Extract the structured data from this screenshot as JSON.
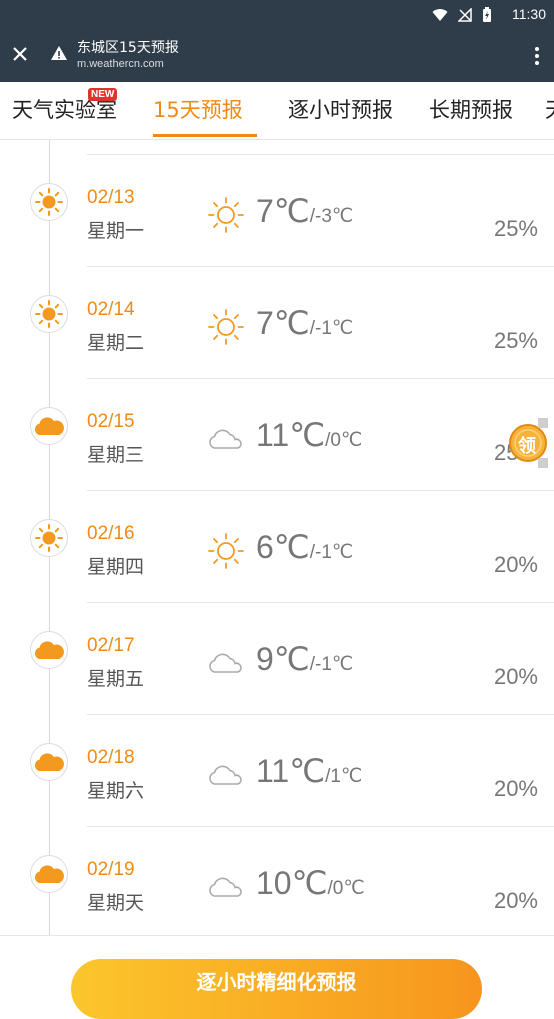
{
  "status_bar": {
    "time": "11:30"
  },
  "toolbar": {
    "title": "东城区15天预报",
    "url": "m.weathercn.com"
  },
  "tabs": [
    {
      "label": "天气实验室",
      "badge": "NEW"
    },
    {
      "label": "15天预报"
    },
    {
      "label": "逐小时预报"
    },
    {
      "label": "长期预报"
    },
    {
      "label": "天"
    }
  ],
  "forecast": [
    {
      "date": "02/13",
      "weekday": "星期一",
      "icon": "sun-icon",
      "high": "7℃",
      "low": "/-3℃",
      "precip": "25%"
    },
    {
      "date": "02/14",
      "weekday": "星期二",
      "icon": "sun-icon",
      "high": "7℃",
      "low": "/-1℃",
      "precip": "25%"
    },
    {
      "date": "02/15",
      "weekday": "星期三",
      "icon": "cloud-icon",
      "high": "11℃",
      "low": "/0℃",
      "precip": "25%"
    },
    {
      "date": "02/16",
      "weekday": "星期四",
      "icon": "sun-icon",
      "high": "6℃",
      "low": "/-1℃",
      "precip": "20%"
    },
    {
      "date": "02/17",
      "weekday": "星期五",
      "icon": "cloud-icon",
      "high": "9℃",
      "low": "/-1℃",
      "precip": "20%"
    },
    {
      "date": "02/18",
      "weekday": "星期六",
      "icon": "cloud-icon",
      "high": "11℃",
      "low": "/1℃",
      "precip": "20%"
    },
    {
      "date": "02/19",
      "weekday": "星期天",
      "icon": "cloud-icon",
      "high": "10℃",
      "low": "/0℃",
      "precip": "20%"
    }
  ],
  "cta": {
    "label": "逐小时精细化预报"
  },
  "floating_coin": {
    "label": "领"
  },
  "colors": {
    "accent": "#f08a16",
    "header": "#2f3d4a"
  }
}
